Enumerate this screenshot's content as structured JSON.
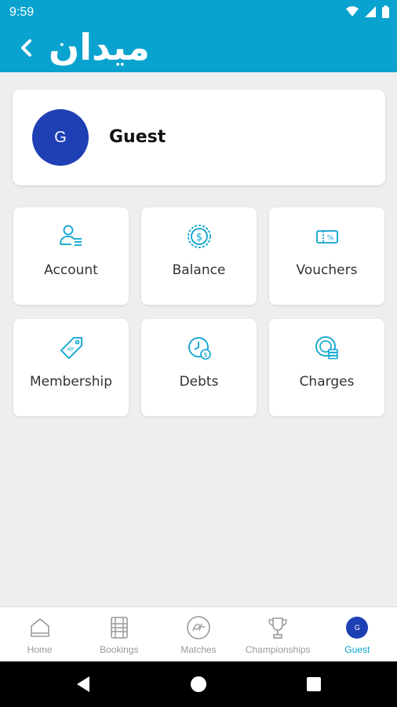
{
  "status_bar": {
    "time": "9:59"
  },
  "app_bar": {
    "logo_text": "ميدان"
  },
  "profile": {
    "avatar_initial": "G",
    "name": "Guest"
  },
  "tiles": [
    {
      "label": "Account",
      "icon": "user-list-icon"
    },
    {
      "label": "Balance",
      "icon": "coin-icon"
    },
    {
      "label": "Vouchers",
      "icon": "voucher-icon"
    },
    {
      "label": "Membership",
      "icon": "tag-icon"
    },
    {
      "label": "Debts",
      "icon": "clock-money-icon"
    },
    {
      "label": "Charges",
      "icon": "coins-stack-icon"
    }
  ],
  "bottom_nav": {
    "items": [
      {
        "label": "Home",
        "icon": "home-icon"
      },
      {
        "label": "Bookings",
        "icon": "bookings-icon"
      },
      {
        "label": "Matches",
        "icon": "play-icon"
      },
      {
        "label": "Championships",
        "icon": "trophy-icon"
      },
      {
        "label": "Guest",
        "icon": "avatar-icon",
        "avatar_initial": "G"
      }
    ],
    "active_index": 4
  },
  "colors": {
    "primary": "#0aa3cf",
    "avatar": "#1f3fb5",
    "background": "#eeeeee"
  }
}
